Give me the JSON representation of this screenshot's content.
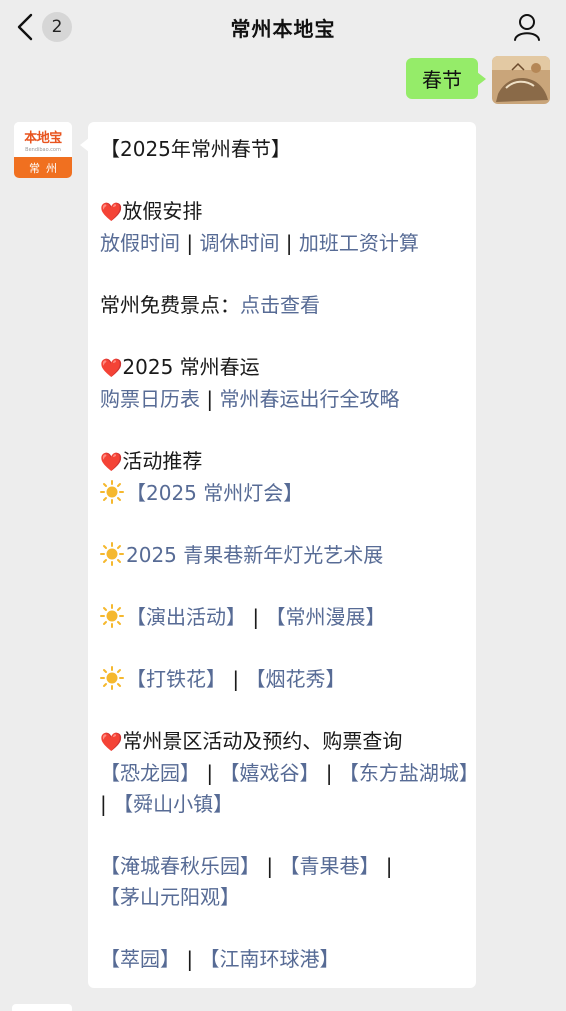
{
  "header": {
    "title": "常州本地宝",
    "unread_badge": "2"
  },
  "outgoing": {
    "text": "春节"
  },
  "bot_avatar": {
    "logo": "本地宝",
    "logo_sub": "Bendibao.com",
    "city": "常州"
  },
  "message": {
    "title": "【2025年常州春节】",
    "sec1_heading": "放假安排",
    "sec1_link1": "放假时间",
    "sec1_link2": "调休时间",
    "sec1_link3": "加班工资计算",
    "sep": " | ",
    "free_spots_label": "常州免费景点：",
    "free_spots_link": "点击查看",
    "sec2_heading": "2025 常州春运",
    "sec2_link1": "购票日历表",
    "sec2_link2": "常州春运出行全攻略",
    "sec3_heading": "活动推荐",
    "lantern_fair": "【2025 常州灯会】",
    "light_show": "2025 青果巷新年灯光艺术展",
    "performances": "【演出活动】",
    "comic_expo": "【常州漫展】",
    "iron_flowers": "【打铁花】",
    "fireworks": "【烟花秀】",
    "sec4_heading": "常州景区活动及预约、购票查询",
    "dino_park": "【恐龙园】",
    "playful_valley": "【嬉戏谷】",
    "salt_lake": "【东方盐湖城】",
    "shunshan": "【舜山小镇】",
    "yancheng": "【淹城春秋乐园】",
    "qingguo": "【青果巷】",
    "maoshan": "【茅山元阳观】",
    "yu_garden": "【萃园】",
    "harbour": "【江南环球港】",
    "pipe_sep": "  |  "
  },
  "colors": {
    "background": "#ededed",
    "outgoing_bubble": "#95ec69",
    "link": "#576b95",
    "heart": "#e0211b",
    "sun": "#f5b82e"
  },
  "icons": {
    "back": "chevron-left-icon",
    "profile": "person-icon",
    "heart": "heart-icon",
    "sun": "sun-icon"
  }
}
